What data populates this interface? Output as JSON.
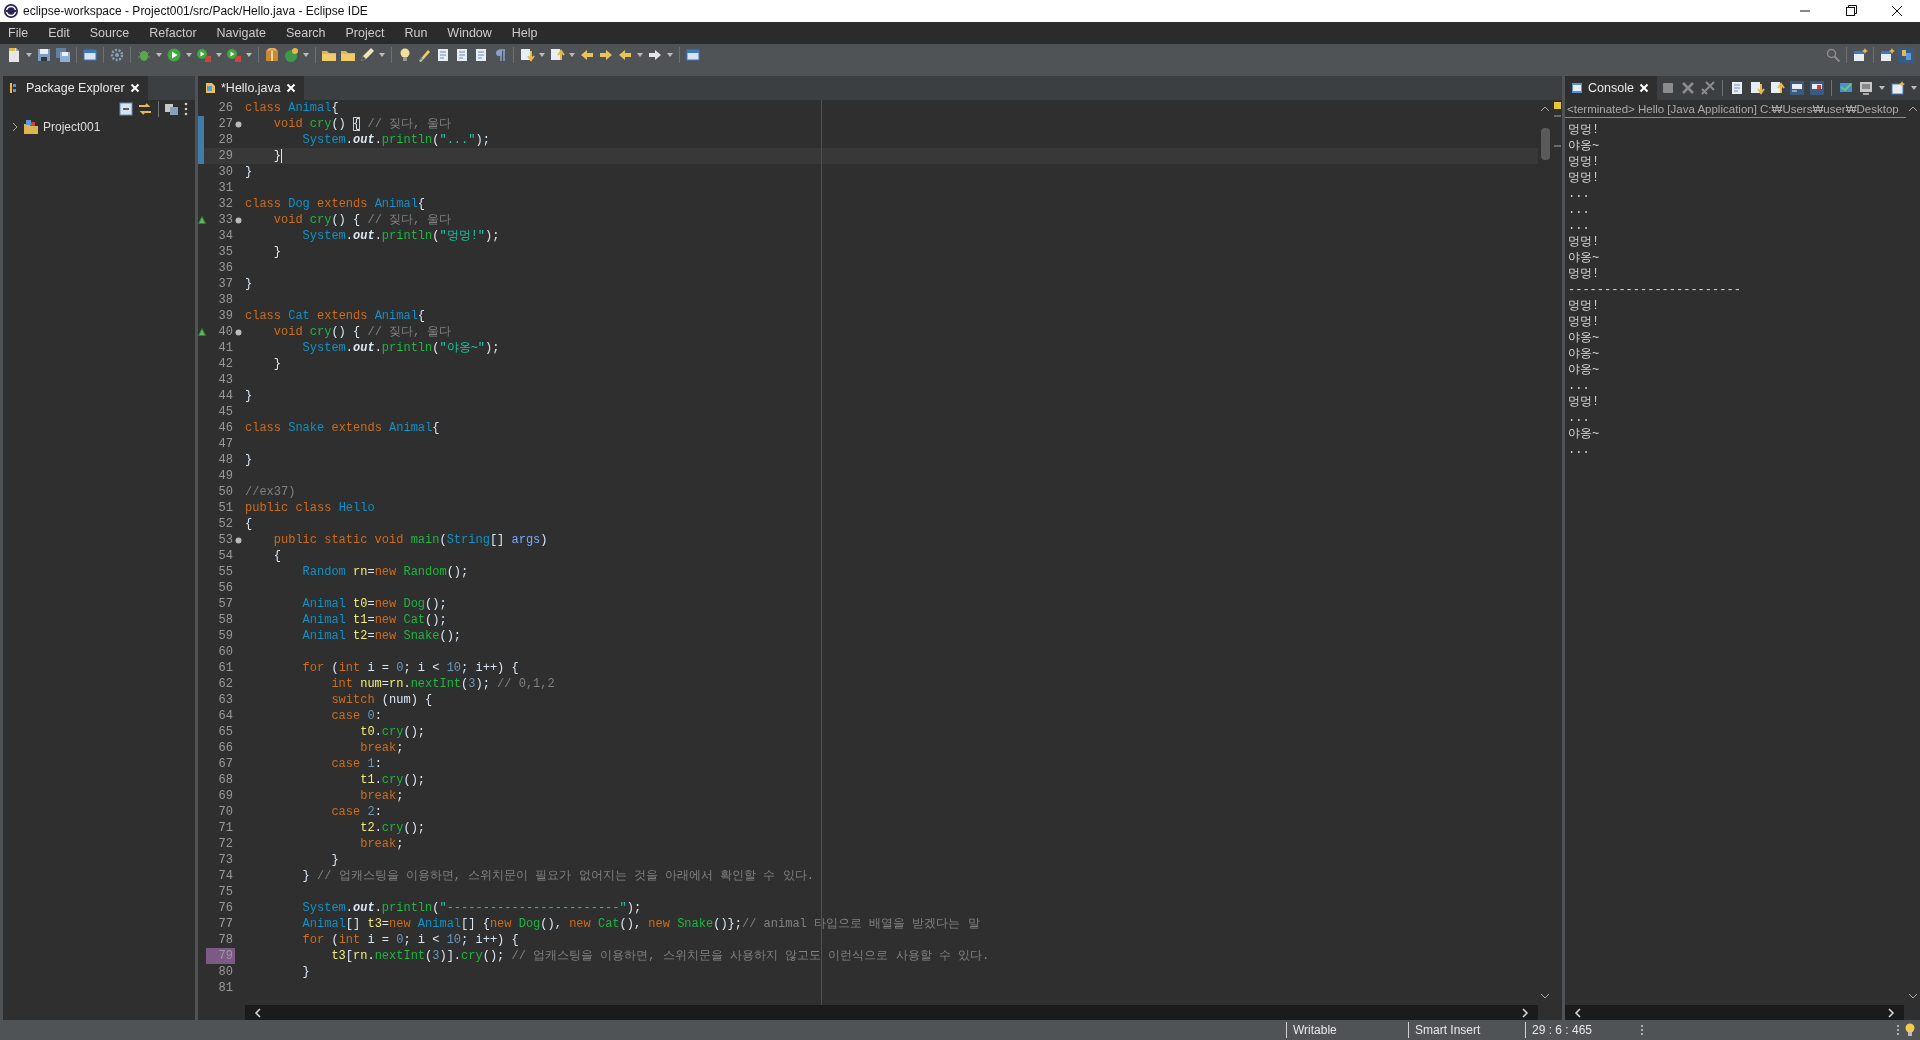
{
  "window": {
    "title": "eclipse-workspace - Project001/src/Pack/Hello.java - Eclipse IDE"
  },
  "menu": [
    "File",
    "Edit",
    "Source",
    "Refactor",
    "Navigate",
    "Search",
    "Project",
    "Run",
    "Window",
    "Help"
  ],
  "package_explorer": {
    "tab": "Package Explorer",
    "items": [
      {
        "label": "Project001",
        "expanded": false
      }
    ]
  },
  "editor": {
    "tab": "*Hello.java",
    "lines": [
      {
        "number": "26",
        "current": false,
        "changed": false,
        "flagged": false,
        "fold": false,
        "override": false,
        "tokens": [
          {
            "kind": "kw",
            "text": "class "
          },
          {
            "kind": "type",
            "text": "Animal"
          },
          {
            "kind": "plain",
            "text": "{"
          }
        ]
      },
      {
        "number": "27",
        "current": false,
        "changed": true,
        "flagged": false,
        "fold": true,
        "override": false,
        "tokens": [
          {
            "kind": "kw",
            "text": "    void "
          },
          {
            "kind": "method",
            "text": "cry"
          },
          {
            "kind": "plain",
            "text": "() "
          },
          {
            "kind": "match",
            "text": "{"
          },
          {
            "kind": "comment",
            "text": " // 짖다, 울다"
          }
        ]
      },
      {
        "number": "28",
        "current": false,
        "changed": true,
        "flagged": false,
        "fold": false,
        "override": false,
        "tokens": [
          {
            "kind": "type",
            "text": "        System"
          },
          {
            "kind": "plain",
            "text": "."
          },
          {
            "kind": "field",
            "text": "out"
          },
          {
            "kind": "plain",
            "text": "."
          },
          {
            "kind": "method",
            "text": "println"
          },
          {
            "kind": "plain",
            "text": "("
          },
          {
            "kind": "str",
            "text": "\"...\""
          },
          {
            "kind": "plain",
            "text": ");"
          }
        ]
      },
      {
        "number": "29",
        "current": true,
        "changed": true,
        "flagged": false,
        "fold": false,
        "override": false,
        "tokens": [
          {
            "kind": "plain",
            "text": "    }"
          }
        ]
      },
      {
        "number": "30",
        "current": false,
        "changed": false,
        "flagged": false,
        "fold": false,
        "override": false,
        "tokens": [
          {
            "kind": "plain",
            "text": "}"
          }
        ]
      },
      {
        "number": "31",
        "current": false,
        "changed": false,
        "flagged": false,
        "fold": false,
        "override": false
      },
      {
        "number": "32",
        "current": false,
        "changed": false,
        "flagged": false,
        "fold": false,
        "override": false,
        "tokens": [
          {
            "kind": "kw",
            "text": "class "
          },
          {
            "kind": "type",
            "text": "Dog"
          },
          {
            "kind": "kw",
            "text": " extends "
          },
          {
            "kind": "type",
            "text": "Animal"
          },
          {
            "kind": "plain",
            "text": "{"
          }
        ]
      },
      {
        "number": "33",
        "current": false,
        "changed": false,
        "flagged": false,
        "fold": true,
        "override": true,
        "tokens": [
          {
            "kind": "kw",
            "text": "    void "
          },
          {
            "kind": "method",
            "text": "cry"
          },
          {
            "kind": "plain",
            "text": "() { "
          },
          {
            "kind": "comment",
            "text": "// 짖다, 울다"
          }
        ]
      },
      {
        "number": "34",
        "current": false,
        "changed": false,
        "flagged": false,
        "fold": false,
        "override": false,
        "tokens": [
          {
            "kind": "type",
            "text": "        System"
          },
          {
            "kind": "plain",
            "text": "."
          },
          {
            "kind": "field",
            "text": "out"
          },
          {
            "kind": "plain",
            "text": "."
          },
          {
            "kind": "method",
            "text": "println"
          },
          {
            "kind": "plain",
            "text": "("
          },
          {
            "kind": "str",
            "text": "\"멍멍!\""
          },
          {
            "kind": "plain",
            "text": ");"
          }
        ]
      },
      {
        "number": "35",
        "current": false,
        "changed": false,
        "flagged": false,
        "fold": false,
        "override": false,
        "tokens": [
          {
            "kind": "plain",
            "text": "    }"
          }
        ]
      },
      {
        "number": "36",
        "current": false,
        "changed": false,
        "flagged": false,
        "fold": false,
        "override": false
      },
      {
        "number": "37",
        "current": false,
        "changed": false,
        "flagged": false,
        "fold": false,
        "override": false,
        "tokens": [
          {
            "kind": "plain",
            "text": "}"
          }
        ]
      },
      {
        "number": "38",
        "current": false,
        "changed": false,
        "flagged": false,
        "fold": false,
        "override": false
      },
      {
        "number": "39",
        "current": false,
        "changed": false,
        "flagged": false,
        "fold": false,
        "override": false,
        "tokens": [
          {
            "kind": "kw",
            "text": "class "
          },
          {
            "kind": "type",
            "text": "Cat"
          },
          {
            "kind": "kw",
            "text": " extends "
          },
          {
            "kind": "type",
            "text": "Animal"
          },
          {
            "kind": "plain",
            "text": "{"
          }
        ]
      },
      {
        "number": "40",
        "current": false,
        "changed": false,
        "flagged": false,
        "fold": true,
        "override": true,
        "tokens": [
          {
            "kind": "kw",
            "text": "    void "
          },
          {
            "kind": "method",
            "text": "cry"
          },
          {
            "kind": "plain",
            "text": "() { "
          },
          {
            "kind": "comment",
            "text": "// 짖다, 울다"
          }
        ]
      },
      {
        "number": "41",
        "current": false,
        "changed": false,
        "flagged": false,
        "fold": false,
        "override": false,
        "tokens": [
          {
            "kind": "type",
            "text": "        System"
          },
          {
            "kind": "plain",
            "text": "."
          },
          {
            "kind": "field",
            "text": "out"
          },
          {
            "kind": "plain",
            "text": "."
          },
          {
            "kind": "method",
            "text": "println"
          },
          {
            "kind": "plain",
            "text": "("
          },
          {
            "kind": "str",
            "text": "\"야옹~\""
          },
          {
            "kind": "plain",
            "text": ");"
          }
        ]
      },
      {
        "number": "42",
        "current": false,
        "changed": false,
        "flagged": false,
        "fold": false,
        "override": false,
        "tokens": [
          {
            "kind": "plain",
            "text": "    }"
          }
        ]
      },
      {
        "number": "43",
        "current": false,
        "changed": false,
        "flagged": false,
        "fold": false,
        "override": false
      },
      {
        "number": "44",
        "current": false,
        "changed": false,
        "flagged": false,
        "fold": false,
        "override": false,
        "tokens": [
          {
            "kind": "plain",
            "text": "}"
          }
        ]
      },
      {
        "number": "45",
        "current": false,
        "changed": false,
        "flagged": false,
        "fold": false,
        "override": false
      },
      {
        "number": "46",
        "current": false,
        "changed": false,
        "flagged": false,
        "fold": false,
        "override": false,
        "tokens": [
          {
            "kind": "kw",
            "text": "class "
          },
          {
            "kind": "type",
            "text": "Snake"
          },
          {
            "kind": "kw",
            "text": " extends "
          },
          {
            "kind": "type",
            "text": "Animal"
          },
          {
            "kind": "plain",
            "text": "{"
          }
        ]
      },
      {
        "number": "47",
        "current": false,
        "changed": false,
        "flagged": false,
        "fold": false,
        "override": false
      },
      {
        "number": "48",
        "current": false,
        "changed": false,
        "flagged": false,
        "fold": false,
        "override": false,
        "tokens": [
          {
            "kind": "plain",
            "text": "}"
          }
        ]
      },
      {
        "number": "49",
        "current": false,
        "changed": false,
        "flagged": false,
        "fold": false,
        "override": false
      },
      {
        "number": "50",
        "current": false,
        "changed": false,
        "flagged": false,
        "fold": false,
        "override": false,
        "tokens": [
          {
            "kind": "comment",
            "text": "//ex37)"
          }
        ]
      },
      {
        "number": "51",
        "current": false,
        "changed": false,
        "flagged": false,
        "fold": false,
        "override": false,
        "tokens": [
          {
            "kind": "kw",
            "text": "public class "
          },
          {
            "kind": "type",
            "text": "Hello"
          }
        ]
      },
      {
        "number": "52",
        "current": false,
        "changed": false,
        "flagged": false,
        "fold": false,
        "override": false,
        "tokens": [
          {
            "kind": "plain",
            "text": "{"
          }
        ]
      },
      {
        "number": "53",
        "current": false,
        "changed": false,
        "flagged": false,
        "fold": true,
        "override": false,
        "tokens": [
          {
            "kind": "kw",
            "text": "    public static void "
          },
          {
            "kind": "method",
            "text": "main"
          },
          {
            "kind": "plain",
            "text": "("
          },
          {
            "kind": "type",
            "text": "String"
          },
          {
            "kind": "plain",
            "text": "[] "
          },
          {
            "kind": "param",
            "text": "args"
          },
          {
            "kind": "plain",
            "text": ")"
          }
        ]
      },
      {
        "number": "54",
        "current": false,
        "changed": false,
        "flagged": false,
        "fold": false,
        "override": false,
        "tokens": [
          {
            "kind": "plain",
            "text": "    {"
          }
        ]
      },
      {
        "number": "55",
        "current": false,
        "changed": false,
        "flagged": false,
        "fold": false,
        "override": false,
        "tokens": [
          {
            "kind": "type",
            "text": "        Random "
          },
          {
            "kind": "var",
            "text": "rn"
          },
          {
            "kind": "plain",
            "text": "="
          },
          {
            "kind": "kw",
            "text": "new "
          },
          {
            "kind": "method",
            "text": "Random"
          },
          {
            "kind": "plain",
            "text": "();"
          }
        ]
      },
      {
        "number": "56",
        "current": false,
        "changed": false,
        "flagged": false,
        "fold": false,
        "override": false
      },
      {
        "number": "57",
        "current": false,
        "changed": false,
        "flagged": false,
        "fold": false,
        "override": false,
        "tokens": [
          {
            "kind": "type",
            "text": "        Animal "
          },
          {
            "kind": "var",
            "text": "t0"
          },
          {
            "kind": "plain",
            "text": "="
          },
          {
            "kind": "kw",
            "text": "new "
          },
          {
            "kind": "method",
            "text": "Dog"
          },
          {
            "kind": "plain",
            "text": "();"
          }
        ]
      },
      {
        "number": "58",
        "current": false,
        "changed": false,
        "flagged": false,
        "fold": false,
        "override": false,
        "tokens": [
          {
            "kind": "type",
            "text": "        Animal "
          },
          {
            "kind": "var",
            "text": "t1"
          },
          {
            "kind": "plain",
            "text": "="
          },
          {
            "kind": "kw",
            "text": "new "
          },
          {
            "kind": "method",
            "text": "Cat"
          },
          {
            "kind": "plain",
            "text": "();"
          }
        ]
      },
      {
        "number": "59",
        "current": false,
        "changed": false,
        "flagged": false,
        "fold": false,
        "override": false,
        "tokens": [
          {
            "kind": "type",
            "text": "        Animal "
          },
          {
            "kind": "var",
            "text": "t2"
          },
          {
            "kind": "plain",
            "text": "="
          },
          {
            "kind": "kw",
            "text": "new "
          },
          {
            "kind": "method",
            "text": "Snake"
          },
          {
            "kind": "plain",
            "text": "();"
          }
        ]
      },
      {
        "number": "60",
        "current": false,
        "changed": false,
        "flagged": false,
        "fold": false,
        "override": false
      },
      {
        "number": "61",
        "current": false,
        "changed": false,
        "flagged": false,
        "fold": false,
        "override": false,
        "tokens": [
          {
            "kind": "kw",
            "text": "        for "
          },
          {
            "kind": "plain",
            "text": "("
          },
          {
            "kind": "kw",
            "text": "int "
          },
          {
            "kind": "plain",
            "text": "i = "
          },
          {
            "kind": "num",
            "text": "0"
          },
          {
            "kind": "plain",
            "text": "; i < "
          },
          {
            "kind": "num",
            "text": "10"
          },
          {
            "kind": "plain",
            "text": "; i++) {"
          }
        ]
      },
      {
        "number": "62",
        "current": false,
        "changed": false,
        "flagged": false,
        "fold": false,
        "override": false,
        "tokens": [
          {
            "kind": "kw",
            "text": "            int "
          },
          {
            "kind": "var",
            "text": "num"
          },
          {
            "kind": "plain",
            "text": "="
          },
          {
            "kind": "var",
            "text": "rn"
          },
          {
            "kind": "plain",
            "text": "."
          },
          {
            "kind": "method",
            "text": "nextInt"
          },
          {
            "kind": "plain",
            "text": "("
          },
          {
            "kind": "num",
            "text": "3"
          },
          {
            "kind": "plain",
            "text": "); "
          },
          {
            "kind": "comment",
            "text": "// 0,1,2"
          }
        ]
      },
      {
        "number": "63",
        "current": false,
        "changed": false,
        "flagged": false,
        "fold": false,
        "override": false,
        "tokens": [
          {
            "kind": "kw",
            "text": "            switch "
          },
          {
            "kind": "plain",
            "text": "(num) {"
          }
        ]
      },
      {
        "number": "64",
        "current": false,
        "changed": false,
        "flagged": false,
        "fold": false,
        "override": false,
        "tokens": [
          {
            "kind": "kw",
            "text": "            case "
          },
          {
            "kind": "num",
            "text": "0"
          },
          {
            "kind": "plain",
            "text": ":"
          }
        ]
      },
      {
        "number": "65",
        "current": false,
        "changed": false,
        "flagged": false,
        "fold": false,
        "override": false,
        "tokens": [
          {
            "kind": "var",
            "text": "                t0"
          },
          {
            "kind": "plain",
            "text": "."
          },
          {
            "kind": "method",
            "text": "cry"
          },
          {
            "kind": "plain",
            "text": "();"
          }
        ]
      },
      {
        "number": "66",
        "current": false,
        "changed": false,
        "flagged": false,
        "fold": false,
        "override": false,
        "tokens": [
          {
            "kind": "kw",
            "text": "                break"
          },
          {
            "kind": "plain",
            "text": ";"
          }
        ]
      },
      {
        "number": "67",
        "current": false,
        "changed": false,
        "flagged": false,
        "fold": false,
        "override": false,
        "tokens": [
          {
            "kind": "kw",
            "text": "            case "
          },
          {
            "kind": "num",
            "text": "1"
          },
          {
            "kind": "plain",
            "text": ":"
          }
        ]
      },
      {
        "number": "68",
        "current": false,
        "changed": false,
        "flagged": false,
        "fold": false,
        "override": false,
        "tokens": [
          {
            "kind": "var",
            "text": "                t1"
          },
          {
            "kind": "plain",
            "text": "."
          },
          {
            "kind": "method",
            "text": "cry"
          },
          {
            "kind": "plain",
            "text": "();"
          }
        ]
      },
      {
        "number": "69",
        "current": false,
        "changed": false,
        "flagged": false,
        "fold": false,
        "override": false,
        "tokens": [
          {
            "kind": "kw",
            "text": "                break"
          },
          {
            "kind": "plain",
            "text": ";"
          }
        ]
      },
      {
        "number": "70",
        "current": false,
        "changed": false,
        "flagged": false,
        "fold": false,
        "override": false,
        "tokens": [
          {
            "kind": "kw",
            "text": "            case "
          },
          {
            "kind": "num",
            "text": "2"
          },
          {
            "kind": "plain",
            "text": ":"
          }
        ]
      },
      {
        "number": "71",
        "current": false,
        "changed": false,
        "flagged": false,
        "fold": false,
        "override": false,
        "tokens": [
          {
            "kind": "var",
            "text": "                t2"
          },
          {
            "kind": "plain",
            "text": "."
          },
          {
            "kind": "method",
            "text": "cry"
          },
          {
            "kind": "plain",
            "text": "();"
          }
        ]
      },
      {
        "number": "72",
        "current": false,
        "changed": false,
        "flagged": false,
        "fold": false,
        "override": false,
        "tokens": [
          {
            "kind": "kw",
            "text": "                break"
          },
          {
            "kind": "plain",
            "text": ";"
          }
        ]
      },
      {
        "number": "73",
        "current": false,
        "changed": false,
        "flagged": false,
        "fold": false,
        "override": false,
        "tokens": [
          {
            "kind": "plain",
            "text": "            }"
          }
        ]
      },
      {
        "number": "74",
        "current": false,
        "changed": false,
        "flagged": false,
        "fold": false,
        "override": false,
        "tokens": [
          {
            "kind": "plain",
            "text": "        } "
          },
          {
            "kind": "comment",
            "text": "// 업캐스팅을 이용하면, 스위치문이 필요가 없어지는 것을 아래에서 확인할 수 있다."
          }
        ]
      },
      {
        "number": "75",
        "current": false,
        "changed": false,
        "flagged": false,
        "fold": false,
        "override": false
      },
      {
        "number": "76",
        "current": false,
        "changed": false,
        "flagged": false,
        "fold": false,
        "override": false,
        "tokens": [
          {
            "kind": "type",
            "text": "        System"
          },
          {
            "kind": "plain",
            "text": "."
          },
          {
            "kind": "field",
            "text": "out"
          },
          {
            "kind": "plain",
            "text": "."
          },
          {
            "kind": "method",
            "text": "println"
          },
          {
            "kind": "plain",
            "text": "("
          },
          {
            "kind": "str",
            "text": "\"------------------------\""
          },
          {
            "kind": "plain",
            "text": ");"
          }
        ]
      },
      {
        "number": "77",
        "current": false,
        "changed": false,
        "flagged": false,
        "fold": false,
        "override": false,
        "tokens": [
          {
            "kind": "type",
            "text": "        Animal"
          },
          {
            "kind": "plain",
            "text": "[] "
          },
          {
            "kind": "var",
            "text": "t3"
          },
          {
            "kind": "plain",
            "text": "="
          },
          {
            "kind": "kw",
            "text": "new "
          },
          {
            "kind": "type",
            "text": "Animal"
          },
          {
            "kind": "plain",
            "text": "[] {"
          },
          {
            "kind": "kw",
            "text": "new "
          },
          {
            "kind": "method",
            "text": "Dog"
          },
          {
            "kind": "plain",
            "text": "(), "
          },
          {
            "kind": "kw",
            "text": "new "
          },
          {
            "kind": "method",
            "text": "Cat"
          },
          {
            "kind": "plain",
            "text": "(), "
          },
          {
            "kind": "kw",
            "text": "new "
          },
          {
            "kind": "method",
            "text": "Snake"
          },
          {
            "kind": "plain",
            "text": "()};"
          },
          {
            "kind": "comment",
            "text": "// animal 타입으로 배열을 받겠다는 말"
          }
        ]
      },
      {
        "number": "78",
        "current": false,
        "changed": false,
        "flagged": false,
        "fold": false,
        "override": false,
        "tokens": [
          {
            "kind": "kw",
            "text": "        for "
          },
          {
            "kind": "plain",
            "text": "("
          },
          {
            "kind": "kw",
            "text": "int "
          },
          {
            "kind": "plain",
            "text": "i = "
          },
          {
            "kind": "num",
            "text": "0"
          },
          {
            "kind": "plain",
            "text": "; i < "
          },
          {
            "kind": "num",
            "text": "10"
          },
          {
            "kind": "plain",
            "text": "; i++) {"
          }
        ]
      },
      {
        "number": "79",
        "current": false,
        "changed": false,
        "flagged": true,
        "fold": false,
        "override": false,
        "tokens": [
          {
            "kind": "var",
            "text": "            t3"
          },
          {
            "kind": "plain",
            "text": "["
          },
          {
            "kind": "var",
            "text": "rn"
          },
          {
            "kind": "plain",
            "text": "."
          },
          {
            "kind": "method",
            "text": "nextInt"
          },
          {
            "kind": "plain",
            "text": "("
          },
          {
            "kind": "num",
            "text": "3"
          },
          {
            "kind": "plain",
            "text": ")]."
          },
          {
            "kind": "method",
            "text": "cry"
          },
          {
            "kind": "plain",
            "text": "(); "
          },
          {
            "kind": "comment",
            "text": "// 업캐스팅을 이용하면, 스위치문을 사용하지 않고도 이런식으로 사용할 수 있다."
          }
        ]
      },
      {
        "number": "80",
        "current": false,
        "changed": false,
        "flagged": false,
        "fold": false,
        "override": false,
        "tokens": [
          {
            "kind": "plain",
            "text": "        }"
          }
        ]
      },
      {
        "number": "81",
        "current": false,
        "changed": false,
        "flagged": false,
        "fold": false,
        "override": false
      }
    ]
  },
  "console": {
    "tab": "Console",
    "header": "<terminated> Hello [Java Application] C:₩Users₩user₩Desktop",
    "lines": [
      "멍멍!",
      "야옹~",
      "멍멍!",
      "멍멍!",
      "...",
      "...",
      "...",
      "멍멍!",
      "야옹~",
      "멍멍!",
      "------------------------",
      "멍멍!",
      "멍멍!",
      "야옹~",
      "야옹~",
      "야옹~",
      "...",
      "멍멍!",
      "...",
      "야옹~",
      "..."
    ]
  },
  "status_bar": {
    "mode": "Writable",
    "insert": "Smart Insert",
    "position": "29 : 6 : 465"
  }
}
